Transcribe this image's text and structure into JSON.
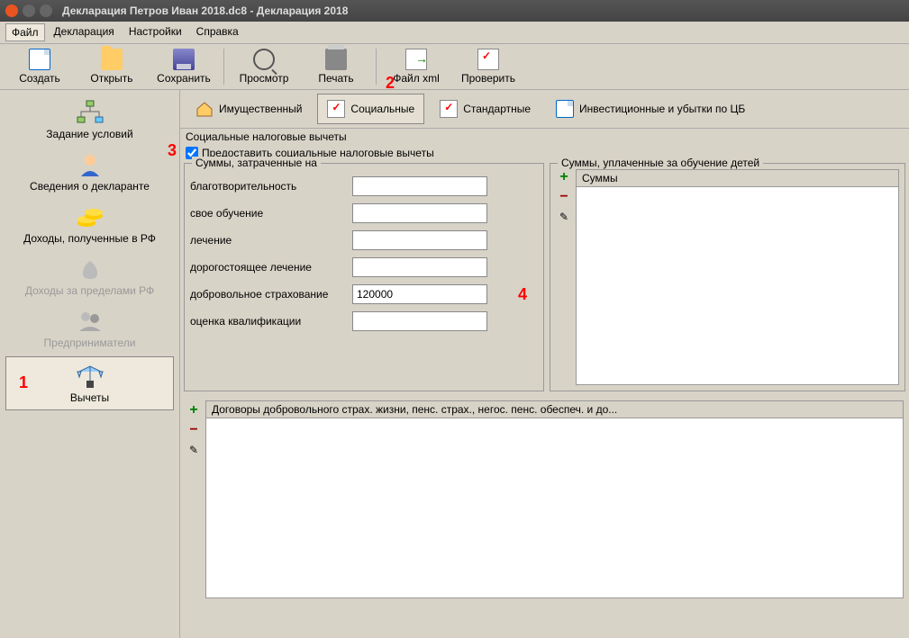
{
  "window": {
    "title": "Декларация Петров Иван 2018.dc8 - Декларация 2018"
  },
  "menu": {
    "file": "Файл",
    "declaration": "Декларация",
    "settings": "Настройки",
    "help": "Справка"
  },
  "toolbar": {
    "create": "Создать",
    "open": "Открыть",
    "save": "Сохранить",
    "preview": "Просмотр",
    "print": "Печать",
    "xml": "Файл xml",
    "check": "Проверить"
  },
  "sidebar": {
    "items": [
      {
        "label": "Задание условий"
      },
      {
        "label": "Сведения о декларанте"
      },
      {
        "label": "Доходы, полученные в РФ"
      },
      {
        "label": "Доходы за пределами РФ"
      },
      {
        "label": "Предприниматели"
      },
      {
        "label": "Вычеты"
      }
    ]
  },
  "tabs": {
    "property": "Имущественный",
    "social": "Социальные",
    "standard": "Стандартные",
    "invest": "Инвестиционные и убытки по ЦБ"
  },
  "section": {
    "title": "Социальные налоговые вычеты",
    "checkbox_label": "Предоставить социальные налоговые вычеты"
  },
  "sums_group": {
    "title": "Суммы, затраченные на",
    "rows": {
      "charity": "благотворительность",
      "own_edu": "свое обучение",
      "treatment": "лечение",
      "exp_treatment": "дорогостоящее лечение",
      "insurance": "добровольное страхование",
      "qualification": "оценка квалификации"
    },
    "values": {
      "charity": "",
      "own_edu": "",
      "treatment": "",
      "exp_treatment": "",
      "insurance": "120000",
      "qualification": ""
    }
  },
  "children_group": {
    "title": "Суммы, уплаченные за обучение детей",
    "column": "Суммы"
  },
  "contracts_group": {
    "title": "Договоры добровольного страх. жизни, пенс. страх., негос. пенс. обеспеч. и до..."
  },
  "annotations": {
    "a1": "1",
    "a2": "2",
    "a3": "3",
    "a4": "4"
  }
}
